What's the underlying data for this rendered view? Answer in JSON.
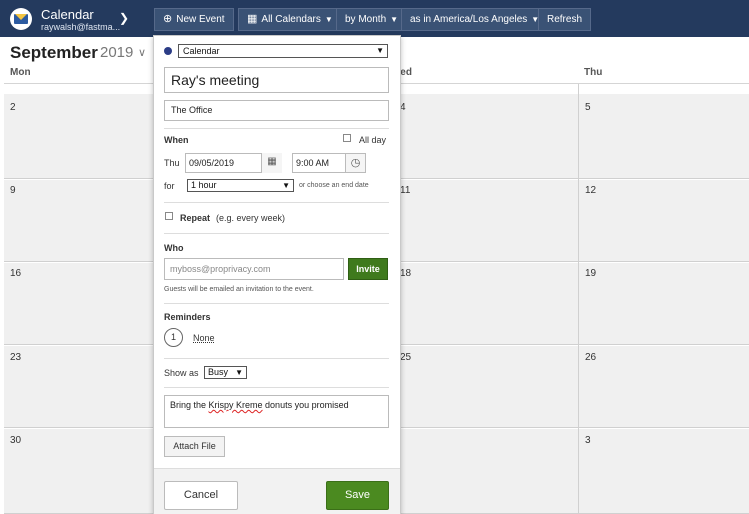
{
  "app": {
    "title": "Calendar",
    "user": "raywalsh@fastma...",
    "logo_icon": "mail-envelope-icon"
  },
  "toolbar": {
    "new_event_label": "New Event",
    "all_calendars_label": "All Calendars",
    "view_label": "by Month",
    "timezone_label": "as in America/Los Angeles",
    "refresh_label": "Refresh"
  },
  "calendar": {
    "month": "September",
    "year": "2019",
    "day_headers": [
      "Mon",
      "Wed",
      "Thu"
    ],
    "col1_dates": [
      "2",
      "9",
      "16",
      "23",
      "30"
    ],
    "col3_dates": [
      "4",
      "11",
      "18",
      "25"
    ],
    "col4_dates": [
      "5",
      "12",
      "19",
      "26",
      "3"
    ]
  },
  "event_form": {
    "calendar_select": "Calendar",
    "calendar_color": "#2b3c86",
    "title": "Ray's meeting",
    "location": "The Office",
    "when_label": "When",
    "all_day_label": "All day",
    "day_label": "Thu",
    "date": "09/05/2019",
    "time": "9:00 AM",
    "for_label": "for",
    "duration": "1 hour",
    "end_date_hint": "or choose an end date",
    "repeat_label": "Repeat",
    "repeat_hint": "(e.g. every week)",
    "who_label": "Who",
    "guest_placeholder": "myboss@proprivacy.com",
    "invite_label": "Invite",
    "guests_note": "Guests will be emailed an invitation to the event.",
    "reminders_label": "Reminders",
    "reminder_count": "1",
    "reminder_value": "None",
    "show_as_label": "Show as",
    "show_as_value": "Busy",
    "description_pre": "Bring the ",
    "description_misspelled": "Krispy Kreme",
    "description_post": " donuts you promised",
    "attach_label": "Attach File",
    "cancel_label": "Cancel",
    "save_label": "Save"
  },
  "colors": {
    "topbar": "#243a5e",
    "save": "#4b8a20",
    "invite": "#3f7a1d"
  }
}
